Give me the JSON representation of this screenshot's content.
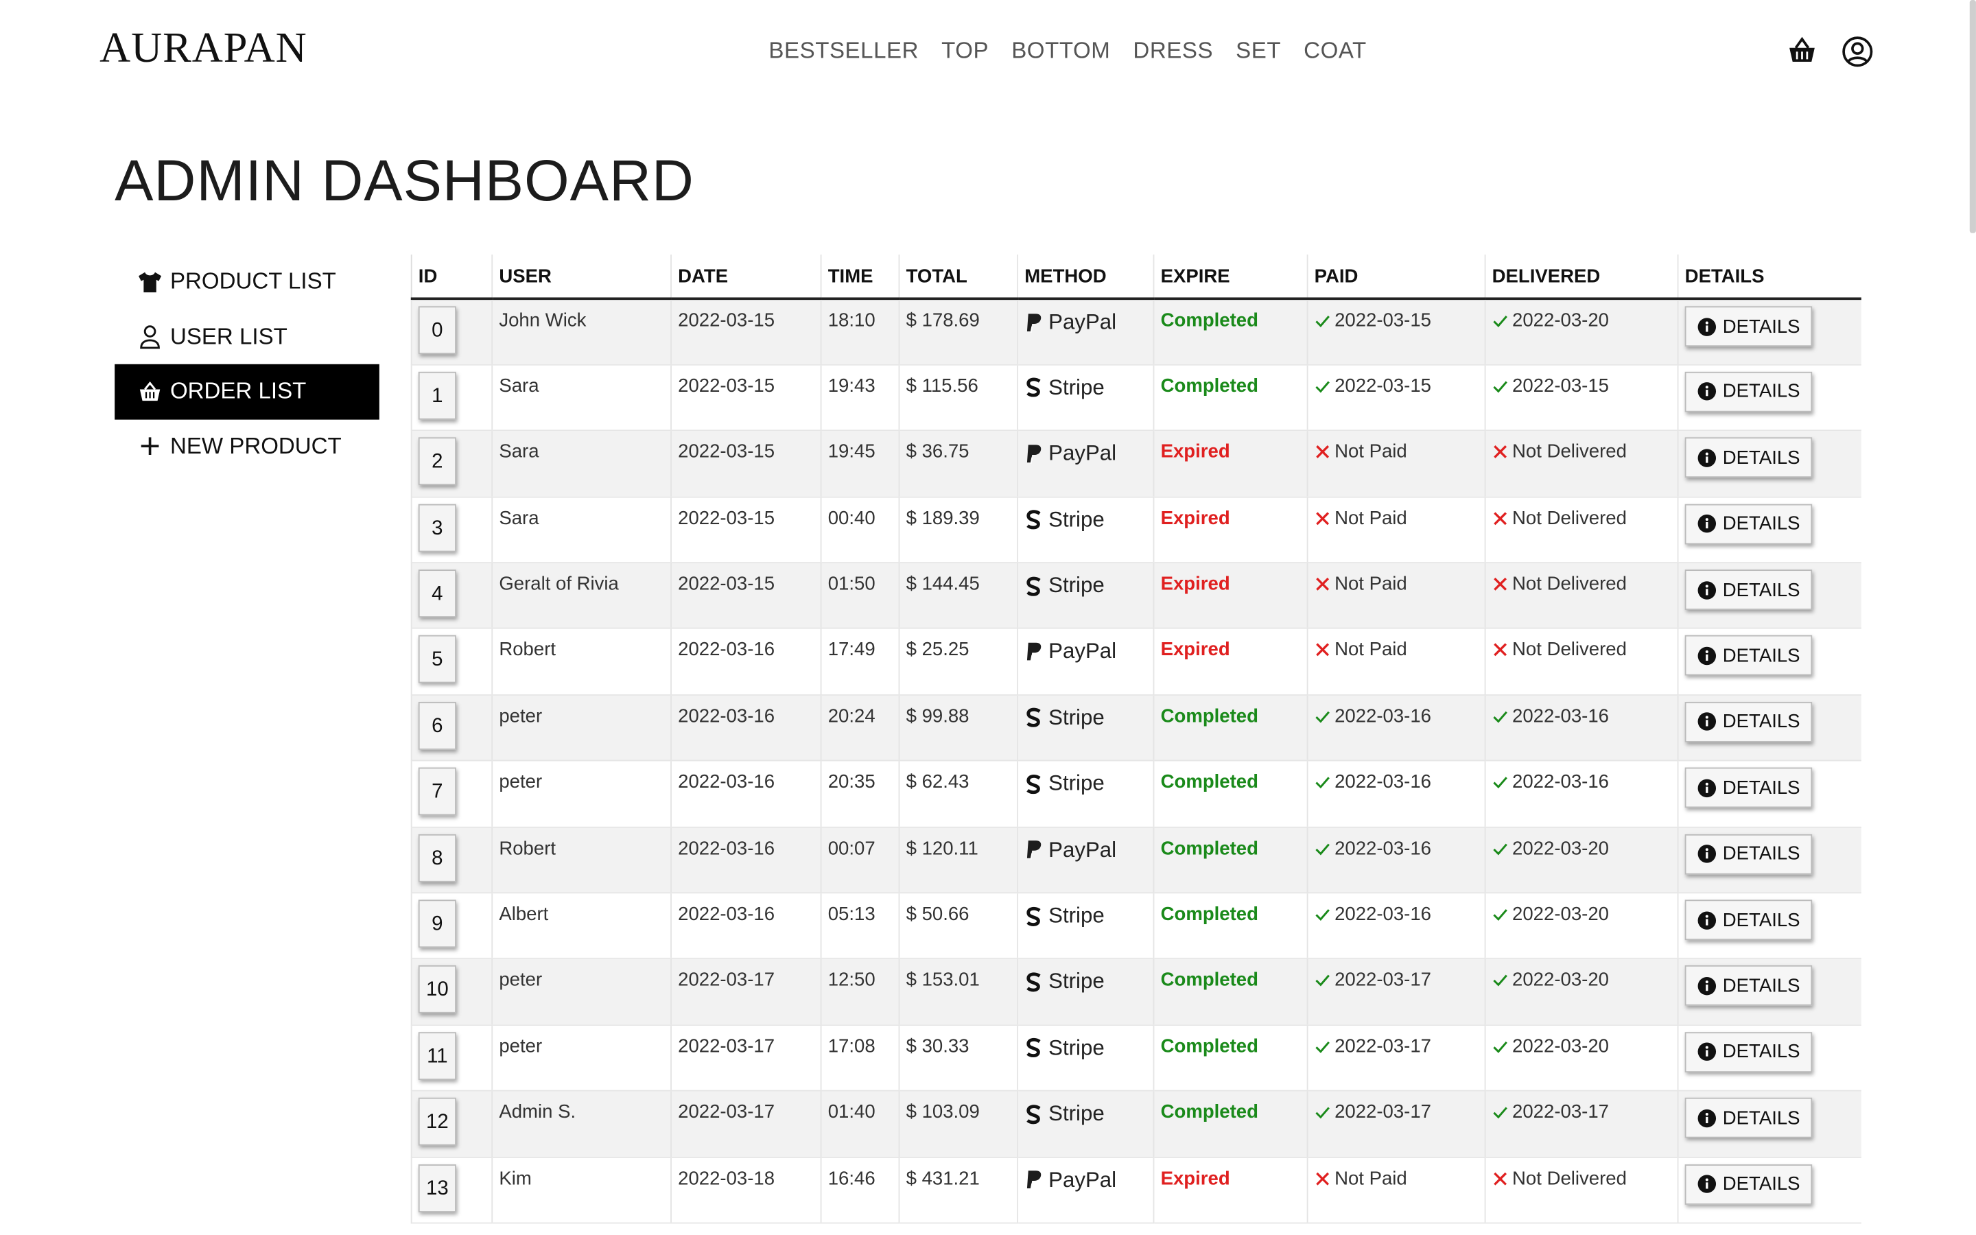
{
  "header": {
    "logo": "AURAPAN",
    "nav": [
      "BESTSELLER",
      "TOP",
      "BOTTOM",
      "DRESS",
      "SET",
      "COAT"
    ],
    "icons": [
      "basket-icon",
      "user-circle-icon"
    ]
  },
  "page_title": "ADMIN DASHBOARD",
  "sidebar": {
    "items": [
      {
        "label": "PRODUCT LIST",
        "icon": "tshirt-icon",
        "active": false
      },
      {
        "label": "USER LIST",
        "icon": "user-icon",
        "active": false
      },
      {
        "label": "ORDER LIST",
        "icon": "basket-icon",
        "active": true
      },
      {
        "label": "NEW PRODUCT",
        "icon": "plus-icon",
        "active": false
      }
    ]
  },
  "table": {
    "columns": [
      "ID",
      "USER",
      "DATE",
      "TIME",
      "TOTAL",
      "METHOD",
      "EXPIRE",
      "PAID",
      "DELIVERED",
      "DETAILS"
    ],
    "details_label": "DETAILS",
    "rows": [
      {
        "id": "0",
        "user": "John Wick",
        "date": "2022-03-15",
        "time": "18:10",
        "total": "$ 178.69",
        "method": "PayPal",
        "expire": "Completed",
        "paid": "2022-03-15",
        "delivered": "2022-03-20"
      },
      {
        "id": "1",
        "user": "Sara",
        "date": "2022-03-15",
        "time": "19:43",
        "total": "$ 115.56",
        "method": "Stripe",
        "expire": "Completed",
        "paid": "2022-03-15",
        "delivered": "2022-03-15"
      },
      {
        "id": "2",
        "user": "Sara",
        "date": "2022-03-15",
        "time": "19:45",
        "total": "$ 36.75",
        "method": "PayPal",
        "expire": "Expired",
        "paid": "Not Paid",
        "delivered": "Not Delivered"
      },
      {
        "id": "3",
        "user": "Sara",
        "date": "2022-03-15",
        "time": "00:40",
        "total": "$ 189.39",
        "method": "Stripe",
        "expire": "Expired",
        "paid": "Not Paid",
        "delivered": "Not Delivered"
      },
      {
        "id": "4",
        "user": "Geralt of Rivia",
        "date": "2022-03-15",
        "time": "01:50",
        "total": "$ 144.45",
        "method": "Stripe",
        "expire": "Expired",
        "paid": "Not Paid",
        "delivered": "Not Delivered"
      },
      {
        "id": "5",
        "user": "Robert",
        "date": "2022-03-16",
        "time": "17:49",
        "total": "$ 25.25",
        "method": "PayPal",
        "expire": "Expired",
        "paid": "Not Paid",
        "delivered": "Not Delivered"
      },
      {
        "id": "6",
        "user": "peter",
        "date": "2022-03-16",
        "time": "20:24",
        "total": "$ 99.88",
        "method": "Stripe",
        "expire": "Completed",
        "paid": "2022-03-16",
        "delivered": "2022-03-16"
      },
      {
        "id": "7",
        "user": "peter",
        "date": "2022-03-16",
        "time": "20:35",
        "total": "$ 62.43",
        "method": "Stripe",
        "expire": "Completed",
        "paid": "2022-03-16",
        "delivered": "2022-03-16"
      },
      {
        "id": "8",
        "user": "Robert",
        "date": "2022-03-16",
        "time": "00:07",
        "total": "$ 120.11",
        "method": "PayPal",
        "expire": "Completed",
        "paid": "2022-03-16",
        "delivered": "2022-03-20"
      },
      {
        "id": "9",
        "user": "Albert",
        "date": "2022-03-16",
        "time": "05:13",
        "total": "$ 50.66",
        "method": "Stripe",
        "expire": "Completed",
        "paid": "2022-03-16",
        "delivered": "2022-03-20"
      },
      {
        "id": "10",
        "user": "peter",
        "date": "2022-03-17",
        "time": "12:50",
        "total": "$ 153.01",
        "method": "Stripe",
        "expire": "Completed",
        "paid": "2022-03-17",
        "delivered": "2022-03-20"
      },
      {
        "id": "11",
        "user": "peter",
        "date": "2022-03-17",
        "time": "17:08",
        "total": "$ 30.33",
        "method": "Stripe",
        "expire": "Completed",
        "paid": "2022-03-17",
        "delivered": "2022-03-20"
      },
      {
        "id": "12",
        "user": "Admin S.",
        "date": "2022-03-17",
        "time": "01:40",
        "total": "$ 103.09",
        "method": "Stripe",
        "expire": "Completed",
        "paid": "2022-03-17",
        "delivered": "2022-03-17"
      },
      {
        "id": "13",
        "user": "Kim",
        "date": "2022-03-18",
        "time": "16:46",
        "total": "$ 431.21",
        "method": "PayPal",
        "expire": "Expired",
        "paid": "Not Paid",
        "delivered": "Not Delivered"
      }
    ]
  },
  "colors": {
    "completed": "#1a8a1a",
    "expired": "#e02020",
    "accent": "#000000"
  }
}
